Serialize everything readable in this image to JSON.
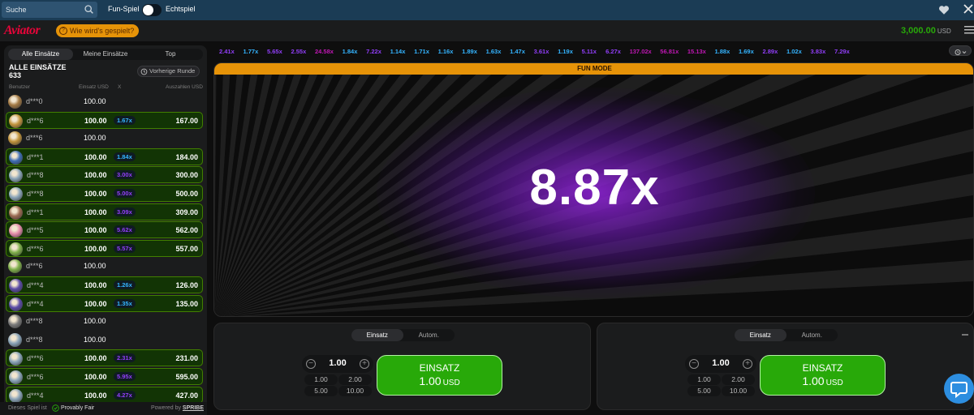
{
  "topbar": {
    "search_placeholder": "Suche",
    "fun_label": "Fun-Spiel",
    "real_label": "Echtspiel"
  },
  "header": {
    "logo": "Aviator",
    "howto": "Wie wird's gespielt?",
    "balance": "3,000.00",
    "currency": "USD"
  },
  "bets_panel": {
    "tabs": [
      "Alle Einsätze",
      "Meine Einsätze",
      "Top"
    ],
    "title": "ALLE EINSÄTZE",
    "count": "633",
    "prev_round": "Vorherige Runde",
    "columns": {
      "user": "Benutzer",
      "bet": "Einsatz USD",
      "x": "X",
      "payout": "Auszahlen USD"
    },
    "rows": [
      {
        "user": "d***0",
        "bet": "100.00",
        "mult": "",
        "payout": "",
        "win": false,
        "avatar_color": "#a37a44"
      },
      {
        "user": "d***6",
        "bet": "100.00",
        "mult": "1.67x",
        "payout": "167.00",
        "win": true,
        "avatar_color": "#c2943c",
        "mult_color": "#34b4ff"
      },
      {
        "user": "d***6",
        "bet": "100.00",
        "mult": "",
        "payout": "",
        "win": false,
        "avatar_color": "#c2943c"
      },
      {
        "user": "d***1",
        "bet": "100.00",
        "mult": "1.84x",
        "payout": "184.00",
        "win": true,
        "avatar_color": "#3e6db5",
        "mult_color": "#34b4ff"
      },
      {
        "user": "d***8",
        "bet": "100.00",
        "mult": "3.00x",
        "payout": "300.00",
        "win": true,
        "avatar_color": "#8aa4b8",
        "mult_color": "#913ef8"
      },
      {
        "user": "d***8",
        "bet": "100.00",
        "mult": "5.00x",
        "payout": "500.00",
        "win": true,
        "avatar_color": "#8aa4b8",
        "mult_color": "#913ef8"
      },
      {
        "user": "d***1",
        "bet": "100.00",
        "mult": "3.09x",
        "payout": "309.00",
        "win": true,
        "avatar_color": "#9a6a52",
        "mult_color": "#913ef8"
      },
      {
        "user": "d***5",
        "bet": "100.00",
        "mult": "5.62x",
        "payout": "562.00",
        "win": true,
        "avatar_color": "#e38aa8",
        "mult_color": "#913ef8"
      },
      {
        "user": "d***6",
        "bet": "100.00",
        "mult": "5.57x",
        "payout": "557.00",
        "win": true,
        "avatar_color": "#7fb04a",
        "mult_color": "#913ef8"
      },
      {
        "user": "d***6",
        "bet": "100.00",
        "mult": "",
        "payout": "",
        "win": false,
        "avatar_color": "#7fb04a"
      },
      {
        "user": "d***4",
        "bet": "100.00",
        "mult": "1.26x",
        "payout": "126.00",
        "win": true,
        "avatar_color": "#5a4aa6",
        "mult_color": "#34b4ff"
      },
      {
        "user": "d***4",
        "bet": "100.00",
        "mult": "1.35x",
        "payout": "135.00",
        "win": true,
        "avatar_color": "#5a4aa6",
        "mult_color": "#34b4ff"
      },
      {
        "user": "d***8",
        "bet": "100.00",
        "mult": "",
        "payout": "",
        "win": false,
        "avatar_color": "#7a7a7a"
      },
      {
        "user": "d***8",
        "bet": "100.00",
        "mult": "",
        "payout": "",
        "win": false,
        "avatar_color": "#8aa4b8"
      },
      {
        "user": "d***6",
        "bet": "100.00",
        "mult": "2.31x",
        "payout": "231.00",
        "win": true,
        "avatar_color": "#8aa4b8",
        "mult_color": "#913ef8"
      },
      {
        "user": "d***6",
        "bet": "100.00",
        "mult": "5.95x",
        "payout": "595.00",
        "win": true,
        "avatar_color": "#8aa4b8",
        "mult_color": "#913ef8"
      },
      {
        "user": "d***4",
        "bet": "100.00",
        "mult": "4.27x",
        "payout": "427.00",
        "win": true,
        "avatar_color": "#8aa4b8",
        "mult_color": "#913ef8"
      }
    ],
    "footer_text": "Dieses Spiel ist",
    "provably_fair": "Provably Fair",
    "powered_by": "Powered by",
    "spribe": "SPRIBE"
  },
  "history": [
    {
      "v": "2.41x",
      "c": "#913ef8"
    },
    {
      "v": "1.77x",
      "c": "#34b4ff"
    },
    {
      "v": "5.65x",
      "c": "#913ef8"
    },
    {
      "v": "2.55x",
      "c": "#913ef8"
    },
    {
      "v": "24.58x",
      "c": "#c017b4"
    },
    {
      "v": "1.84x",
      "c": "#34b4ff"
    },
    {
      "v": "7.22x",
      "c": "#913ef8"
    },
    {
      "v": "1.14x",
      "c": "#34b4ff"
    },
    {
      "v": "1.71x",
      "c": "#34b4ff"
    },
    {
      "v": "1.16x",
      "c": "#34b4ff"
    },
    {
      "v": "1.89x",
      "c": "#34b4ff"
    },
    {
      "v": "1.63x",
      "c": "#34b4ff"
    },
    {
      "v": "1.47x",
      "c": "#34b4ff"
    },
    {
      "v": "3.61x",
      "c": "#913ef8"
    },
    {
      "v": "1.19x",
      "c": "#34b4ff"
    },
    {
      "v": "5.11x",
      "c": "#913ef8"
    },
    {
      "v": "6.27x",
      "c": "#913ef8"
    },
    {
      "v": "137.02x",
      "c": "#c017b4"
    },
    {
      "v": "56.81x",
      "c": "#c017b4"
    },
    {
      "v": "15.13x",
      "c": "#c017b4"
    },
    {
      "v": "1.88x",
      "c": "#34b4ff"
    },
    {
      "v": "1.69x",
      "c": "#34b4ff"
    },
    {
      "v": "2.89x",
      "c": "#913ef8"
    },
    {
      "v": "1.02x",
      "c": "#34b4ff"
    },
    {
      "v": "3.83x",
      "c": "#913ef8"
    },
    {
      "v": "7.29x",
      "c": "#913ef8"
    }
  ],
  "game": {
    "fun_mode": "FUN MODE",
    "multiplier": "8.87x"
  },
  "bet_controls": [
    {
      "tabs": [
        "Einsatz",
        "Autom."
      ],
      "stake": "1.00",
      "quick": [
        "1.00",
        "2.00",
        "5.00",
        "10.00"
      ],
      "button_label": "EINSATZ",
      "button_amount": "1.00",
      "button_currency": "USD"
    },
    {
      "tabs": [
        "Einsatz",
        "Autom."
      ],
      "stake": "1.00",
      "quick": [
        "1.00",
        "2.00",
        "5.00",
        "10.00"
      ],
      "button_label": "EINSATZ",
      "button_amount": "1.00",
      "button_currency": "USD"
    }
  ],
  "colors": {
    "brand_red": "#e50539",
    "win_green": "#28a909",
    "accent_orange": "#e69308"
  }
}
